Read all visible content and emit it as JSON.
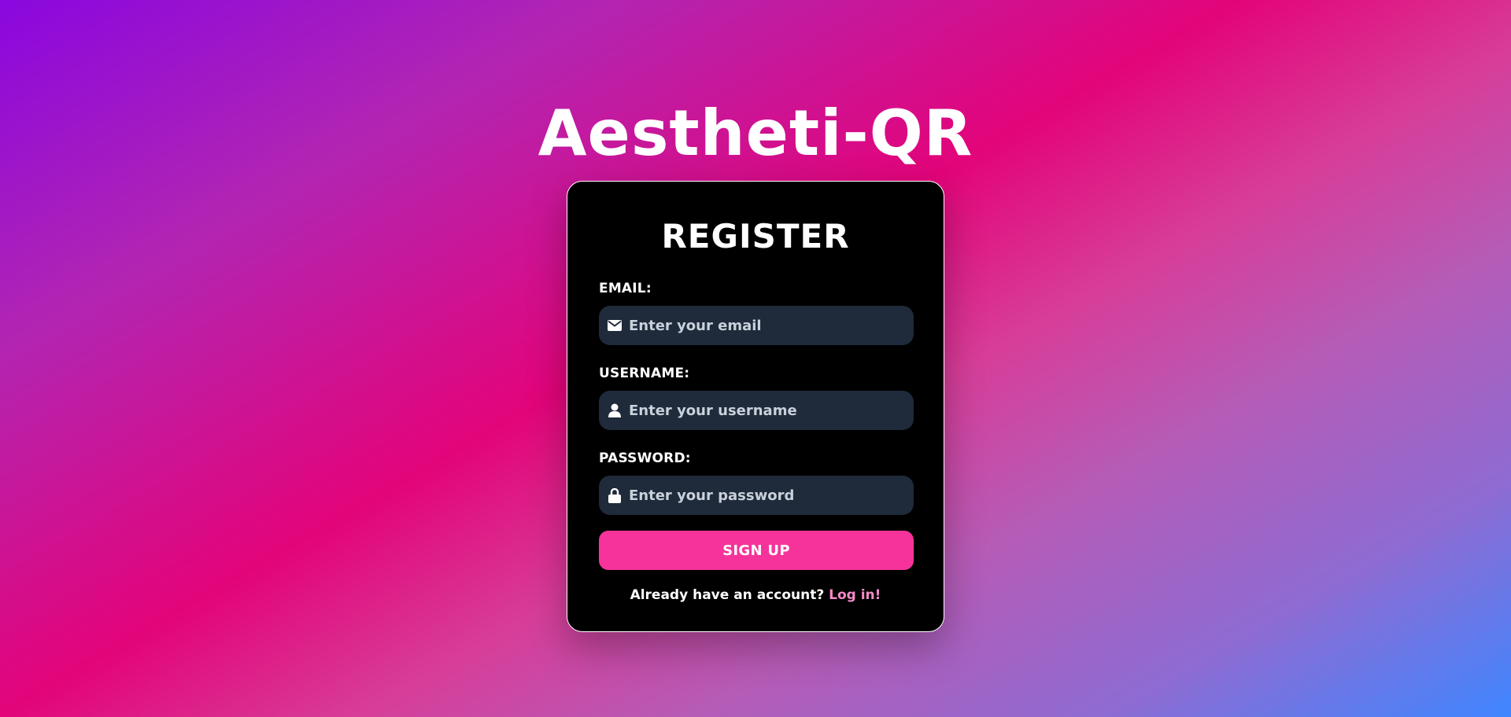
{
  "app": {
    "title": "Aestheti-QR"
  },
  "register_form": {
    "title": "REGISTER",
    "email": {
      "label": "EMAIL:",
      "placeholder": "Enter your email",
      "value": "",
      "icon": "envelope-icon"
    },
    "username": {
      "label": "USERNAME:",
      "placeholder": "Enter your username",
      "value": "",
      "icon": "user-icon"
    },
    "password": {
      "label": "PASSWORD:",
      "placeholder": "Enter your password",
      "value": "",
      "icon": "lock-icon"
    },
    "submit_label": "SIGN UP",
    "login_prompt": "Already have an account?",
    "login_link": "Log in!"
  },
  "colors": {
    "button": "#f5339a",
    "input_background": "#1f2a3a",
    "link": "#f48bc8",
    "card_background": "#000000"
  }
}
